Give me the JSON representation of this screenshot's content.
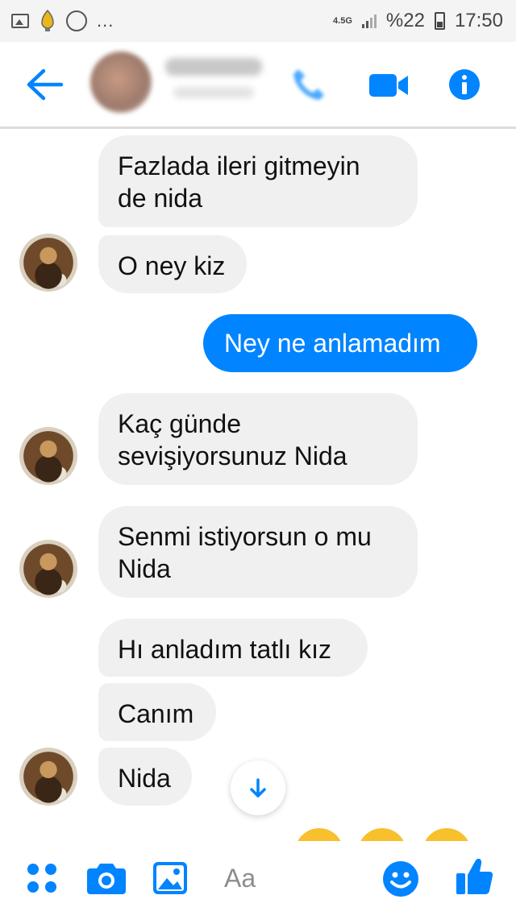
{
  "status_bar": {
    "more": "...",
    "network": "4.5G",
    "battery": "%22",
    "time": "17:50"
  },
  "composer": {
    "placeholder": "Aa"
  },
  "messages": [
    {
      "text": "Fazlada ileri gitmeyin\nde nida"
    },
    {
      "text": "O ney kiz"
    },
    {
      "text": "Ney ne anlamadım"
    },
    {
      "text": "Kaç günde\nsevişiyorsunuz Nida"
    },
    {
      "text": "Senmi istiyorsun o mu\nNida"
    },
    {
      "text": "Hı anladım tatlı kız"
    },
    {
      "text": "Canım"
    },
    {
      "text": "Nida"
    }
  ],
  "colors": {
    "accent": "#0084ff",
    "incoming_bubble": "#f1f0f0",
    "outgoing_bubble": "#0084ff"
  }
}
